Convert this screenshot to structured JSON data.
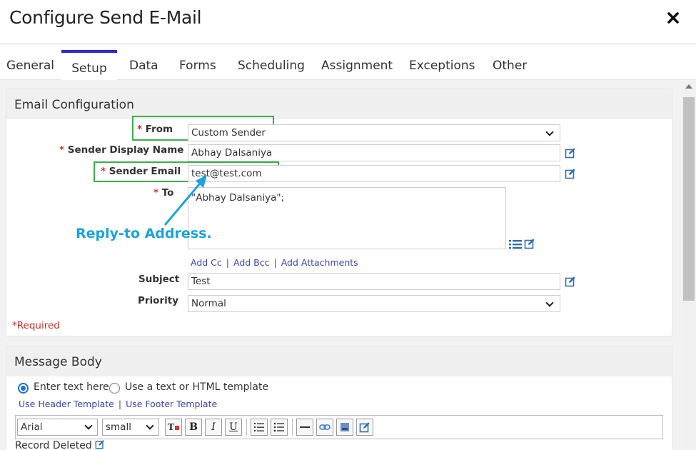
{
  "dialog": {
    "title": "Configure Send E-Mail"
  },
  "tabs": [
    {
      "label": "General"
    },
    {
      "label": "Setup"
    },
    {
      "label": "Data"
    },
    {
      "label": "Forms"
    },
    {
      "label": "Scheduling"
    },
    {
      "label": "Assignment"
    },
    {
      "label": "Exceptions"
    },
    {
      "label": "Other"
    }
  ],
  "active_tab": "Setup",
  "email_config": {
    "title": "Email Configuration",
    "required_marker": "*",
    "from": {
      "label": "From",
      "value": "Custom Sender"
    },
    "sender_display_name": {
      "label": "Sender Display Name",
      "value": "Abhay Dalsaniya"
    },
    "sender_email": {
      "label": "Sender Email",
      "value": "test@test.com"
    },
    "to": {
      "label": "To",
      "value": "\"Abhay Dalsaniya\";"
    },
    "links": {
      "add_cc": "Add Cc",
      "add_bcc": "Add Bcc",
      "add_attachments": "Add Attachments",
      "separator": "|"
    },
    "subject": {
      "label": "Subject",
      "value": "Test"
    },
    "priority": {
      "label": "Priority",
      "value": "Normal"
    },
    "required_note": "*Required"
  },
  "annotation": {
    "text": "Reply-to Address.",
    "color": "#19a4e0"
  },
  "message_body": {
    "title": "Message Body",
    "option_text": "Enter text here",
    "option_template": "Use a text or HTML template",
    "use_header": "Use Header Template",
    "use_footer": "Use Footer Template",
    "separator": "|",
    "font": "Arial",
    "size": "small",
    "editor_text": "Record Deleted"
  },
  "colors": {
    "tab_accent": "#2b2bd1",
    "highlight": "#3bb14a",
    "required": "#d9302c",
    "link": "#3a45b8",
    "radio": "#1e6fe0"
  }
}
